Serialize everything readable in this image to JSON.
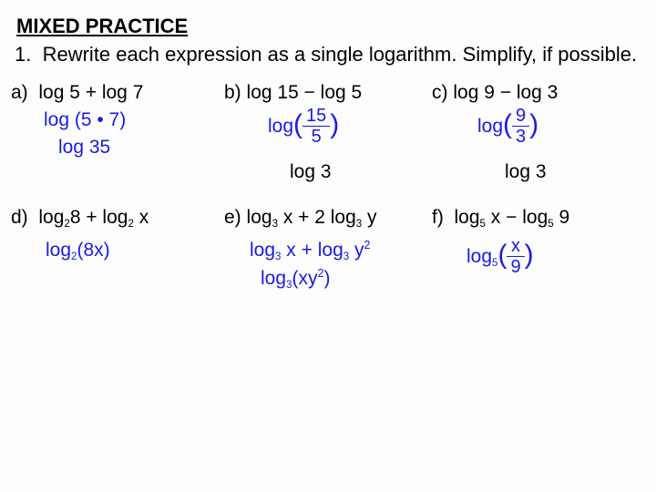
{
  "title": "MIXED PRACTICE",
  "instruction_num": "1.",
  "instruction_text": "Rewrite each expression as a single logarithm.  Simplify, if possible.",
  "row1": {
    "a": {
      "label": "a)",
      "expr": "log 5 + log 7",
      "step1": "log (5 • 7)",
      "step2": "log 35"
    },
    "b": {
      "label": "b)",
      "expr": "log 15 − log 5",
      "frac_prefix": "log",
      "frac_num": "15",
      "frac_den": "5",
      "result": "log 3"
    },
    "c": {
      "label": "c)",
      "expr": "log 9 − log 3",
      "frac_prefix": "log",
      "frac_num": "9",
      "frac_den": "3",
      "result": "log 3"
    }
  },
  "row2": {
    "d": {
      "label": "d)",
      "expr_prefix": "log",
      "expr_sub": "2",
      "expr_mid": "8 + log",
      "expr_sub2": "2",
      "expr_suffix": " x",
      "ans_prefix": "log",
      "ans_sub": "2",
      "ans_body": "(8x)"
    },
    "e": {
      "label": "e)",
      "expr_prefix": "log",
      "expr_sub": "3",
      "expr_mid": " x + 2 log",
      "expr_sub2": "3",
      "expr_suffix": " y",
      "step1_prefix": "log",
      "step1_sub": "3",
      "step1_mid": " x + log",
      "step1_sub2": "3",
      "step1_suffix": " y",
      "step1_sup": "2",
      "ans_prefix": "log",
      "ans_sub": "3",
      "ans_body_pre": "(xy",
      "ans_body_sup": "2",
      "ans_body_post": ")"
    },
    "f": {
      "label": "f)",
      "expr_prefix": "log",
      "expr_sub": "5",
      "expr_mid": " x − log",
      "expr_sub2": "5",
      "expr_suffix": " 9",
      "ans_prefix": "log",
      "ans_sub": "5",
      "frac_num": "x",
      "frac_den": "9"
    }
  }
}
